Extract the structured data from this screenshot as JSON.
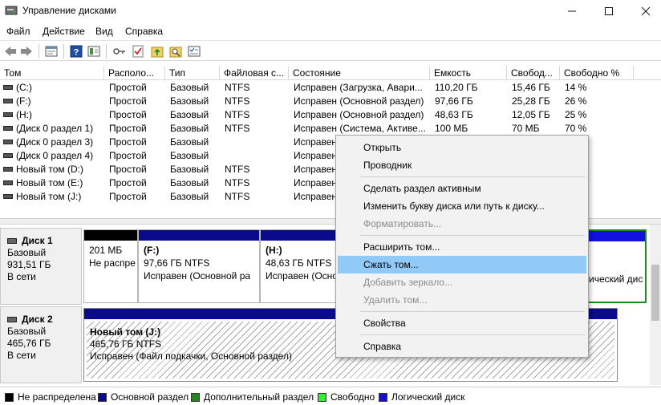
{
  "window": {
    "title": "Управление дисками"
  },
  "menu": [
    "Файл",
    "Действие",
    "Вид",
    "Справка"
  ],
  "columns": [
    "Том",
    "Располо...",
    "Тип",
    "Файловая с...",
    "Состояние",
    "Емкость",
    "Свобод...",
    "Свободно %"
  ],
  "volumes": [
    [
      "(C:)",
      "Простой",
      "Базовый",
      "NTFS",
      "Исправен (Загрузка, Авари...",
      "110,20 ГБ",
      "15,46 ГБ",
      "14 %"
    ],
    [
      "(F:)",
      "Простой",
      "Базовый",
      "NTFS",
      "Исправен (Основной раздел)",
      "97,66 ГБ",
      "25,28 ГБ",
      "26 %"
    ],
    [
      "(H:)",
      "Простой",
      "Базовый",
      "NTFS",
      "Исправен (Основной раздел)",
      "48,63 ГБ",
      "12,05 ГБ",
      "25 %"
    ],
    [
      "(Диск 0 раздел 1)",
      "Простой",
      "Базовый",
      "NTFS",
      "Исправен (Система, Активе...",
      "100 МБ",
      "70 МБ",
      "70 %"
    ],
    [
      "(Диск 0 раздел 3)",
      "Простой",
      "Базовый",
      "",
      "Исправен",
      "",
      "",
      ""
    ],
    [
      "(Диск 0 раздел 4)",
      "Простой",
      "Базовый",
      "",
      "Исправен",
      "",
      "",
      ""
    ],
    [
      "Новый том (D:)",
      "Простой",
      "Базовый",
      "NTFS",
      "Исправен",
      "",
      "",
      ""
    ],
    [
      "Новый том (E:)",
      "Простой",
      "Базовый",
      "NTFS",
      "Исправен",
      "",
      "",
      ""
    ],
    [
      "Новый том (J:)",
      "Простой",
      "Базовый",
      "NTFS",
      "Исправен",
      "",
      "",
      ""
    ]
  ],
  "disks": [
    {
      "name": "Диск 1",
      "type": "Базовый",
      "size": "931,51 ГБ",
      "status": "В сети",
      "partitions": [
        {
          "name": "",
          "size": "201 МБ",
          "status": "Не распре",
          "color": "#000000"
        },
        {
          "name": "(F:)",
          "size": "97,66 ГБ NTFS",
          "status": "Исправен (Основной ра",
          "color": "#0a0a8c"
        },
        {
          "name": "(H:)",
          "size": "48,63 ГБ NTFS",
          "status": "Исправен (Осно",
          "color": "#0a0a8c"
        },
        {
          "name": "",
          "size": "",
          "status": "ический дис",
          "color": "#1010e0"
        }
      ]
    },
    {
      "name": "Диск 2",
      "type": "Базовый",
      "size": "465,76 ГБ",
      "status": "В сети",
      "partitions": [
        {
          "name": "Новый том (J:)",
          "size": "465,76 ГБ NTFS",
          "status": "Исправен (Файл подкачки, Основной раздел)",
          "color": "#0a0a8c"
        }
      ]
    }
  ],
  "legend": [
    {
      "label": "Не распределена",
      "color": "#000000"
    },
    {
      "label": "Основной раздел",
      "color": "#0a0a8c"
    },
    {
      "label": "Дополнительный раздел",
      "color": "#1a8c1a"
    },
    {
      "label": "Свободно",
      "color": "#33ee33"
    },
    {
      "label": "Логический диск",
      "color": "#1010e0"
    }
  ],
  "context_menu": {
    "items": [
      {
        "label": "Открыть",
        "disabled": false
      },
      {
        "label": "Проводник",
        "disabled": false
      },
      {
        "label": "Сделать раздел активным",
        "disabled": false
      },
      {
        "label": "Изменить букву диска или путь к диску...",
        "disabled": false
      },
      {
        "label": "Форматировать...",
        "disabled": true
      },
      {
        "label": "Расширить том...",
        "disabled": false
      },
      {
        "label": "Сжать том...",
        "disabled": false,
        "highlighted": true
      },
      {
        "label": "Добавить зеркало...",
        "disabled": true
      },
      {
        "label": "Удалить том...",
        "disabled": true
      },
      {
        "label": "Свойства",
        "disabled": false
      },
      {
        "label": "Справка",
        "disabled": false
      }
    ]
  },
  "colors": {
    "accent_highlight": "#91c9f7",
    "primary_partition": "#0a0a8c",
    "extended_partition": "#1a8c1a",
    "free": "#33ee33",
    "logical": "#1010e0",
    "unallocated": "#000000"
  },
  "icons": [
    "back-arrow-icon",
    "forward-arrow-icon",
    "properties-icon",
    "help-icon",
    "view-icon",
    "key-icon",
    "checklist-icon",
    "folder-up-icon",
    "search-folder-icon",
    "settings-icon"
  ]
}
